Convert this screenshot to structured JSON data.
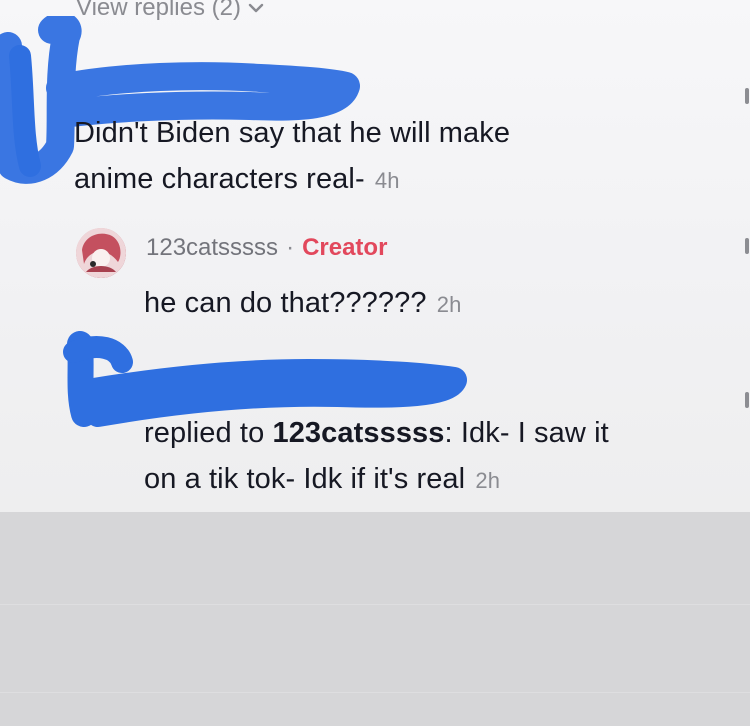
{
  "view_replies": {
    "label": "View replies (2)"
  },
  "comment_1": {
    "text_line1": "Didn't Biden say that he will make",
    "text_line2": "anime characters real-",
    "time": "4h"
  },
  "reply_1": {
    "username": "123catsssss",
    "separator": "·",
    "badge": "Creator",
    "text": "he can do that??????",
    "time": "2h"
  },
  "reply_2": {
    "prefix": "replied to ",
    "mention": "123catsssss",
    "after_mention": ": Idk- I saw it",
    "text_line2": "on a tik tok- Idk if it's real",
    "time": "2h"
  },
  "colors": {
    "scribble": "#2f6fe0",
    "creator_badge": "#e2485c",
    "muted_text": "#8a8b91",
    "primary_text": "#161823"
  },
  "icons": {
    "view_replies_chevron": "chevron-down-icon",
    "avatar": "avatar"
  }
}
